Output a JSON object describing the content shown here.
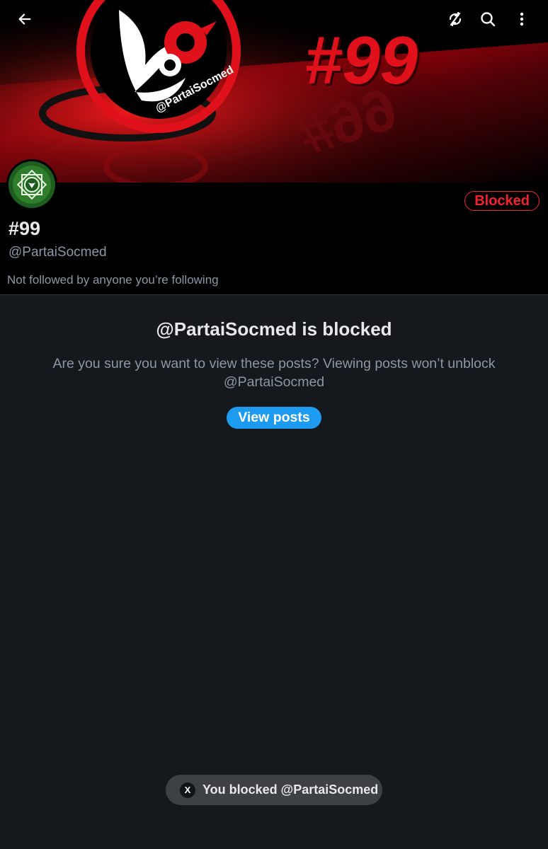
{
  "banner": {
    "hashtag_text": "#99",
    "mirror_text": "#99",
    "logo_handle_text": "@PartaiSocmed",
    "colors": {
      "red": "#e0111b",
      "dark_red": "#4a0306",
      "black": "#000000",
      "white": "#ffffff"
    }
  },
  "topbar": {
    "icons": [
      "back-arrow-icon",
      "refresh-off-icon",
      "search-icon",
      "more-vertical-icon"
    ]
  },
  "profile": {
    "display_name": "#99",
    "handle": "@PartaiSocmed",
    "followed_note": "Not followed by anyone you’re following",
    "blocked_label": "Blocked",
    "avatar_icon": "green-emblem-avatar"
  },
  "blocked_notice": {
    "title": "@PartaiSocmed is blocked",
    "body": "Are you sure you want to view these posts? Viewing posts won’t unblock @PartaiSocmed",
    "view_button": "View posts"
  },
  "toast": {
    "logo": "X",
    "text": "You blocked @PartaiSocmed"
  },
  "colors": {
    "background": "#15181c",
    "header_bg": "#000000",
    "accent_blue": "#1d9bf0",
    "blocked_red": "#f4212e",
    "secondary_text": "#8b98a5"
  }
}
